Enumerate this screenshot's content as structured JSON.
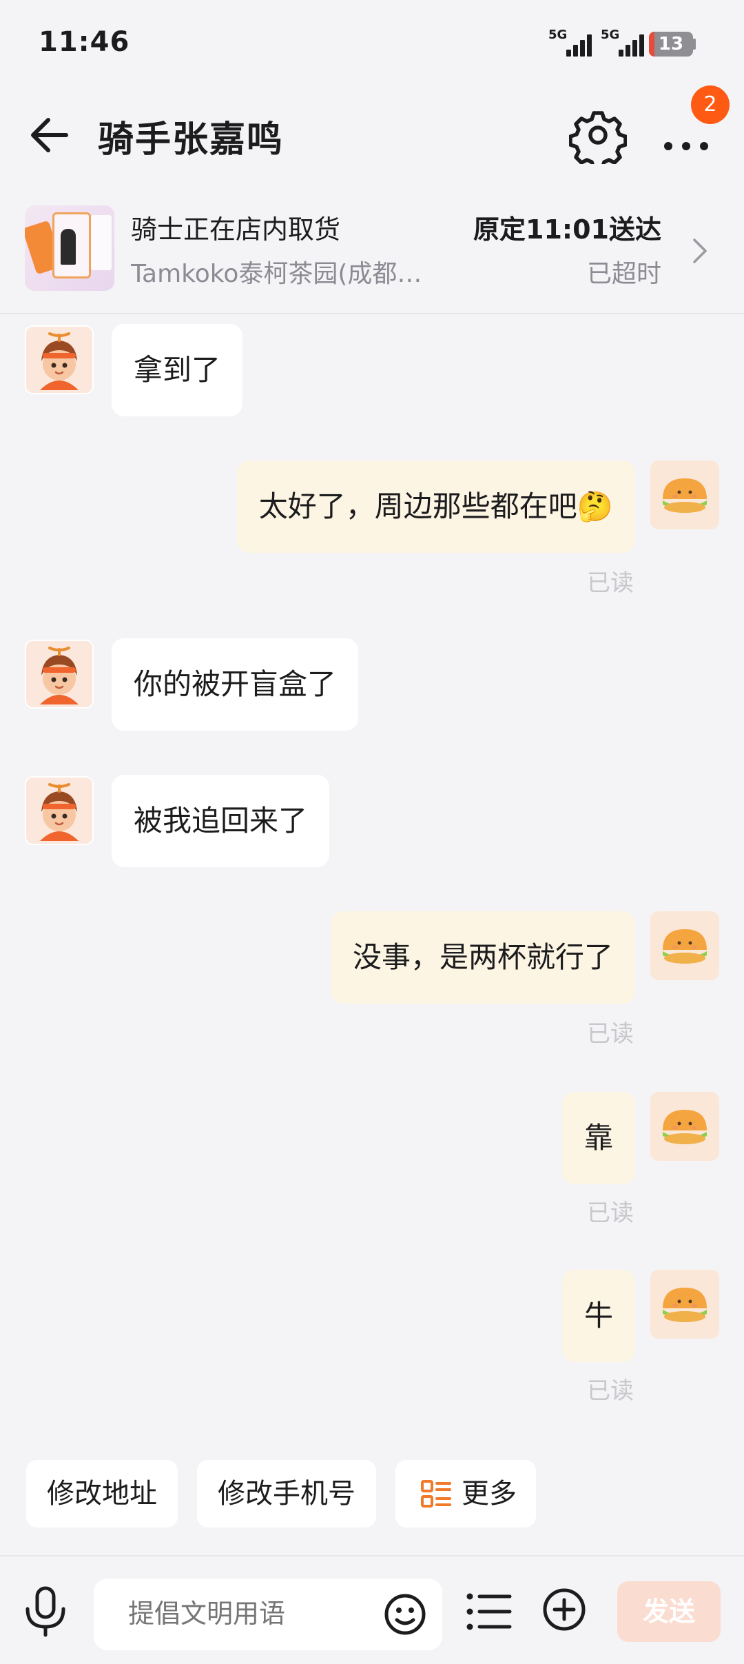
{
  "status_bar": {
    "time": "11:46",
    "network_1": "5G",
    "network_2": "5G",
    "battery_percent": 13,
    "battery_text": "13"
  },
  "header": {
    "title": "骑手张嘉鸣",
    "more_badge": "2",
    "icons": [
      "back-arrow-icon",
      "gear-icon",
      "more-dots-icon"
    ]
  },
  "order": {
    "status": "骑士正在店内取货",
    "shop": "Tamkoko泰柯茶园(成都双...",
    "eta": "原定11:01送达",
    "overdue": "已超时"
  },
  "messages": [
    {
      "from": "rider",
      "text": "拿到了"
    },
    {
      "from": "me",
      "text": "太好了，周边那些都在吧🤔",
      "status": "已读"
    },
    {
      "from": "rider",
      "text": "你的被开盲盒了"
    },
    {
      "from": "rider",
      "text": "被我追回来了"
    },
    {
      "from": "me",
      "text": "没事，是两杯就行了",
      "status": "已读"
    },
    {
      "from": "me",
      "text": "靠",
      "status": "已读"
    },
    {
      "from": "me",
      "text": "牛",
      "status": "已读"
    }
  ],
  "quick_actions": {
    "change_address": "修改地址",
    "change_phone": "修改手机号",
    "more": "更多"
  },
  "input_bar": {
    "placeholder": "提倡文明用语",
    "send_label": "发送"
  },
  "colors": {
    "accent_orange": "#ff5a14",
    "outgoing_bubble": "#fdf5e4",
    "incoming_bubble": "#ffffff",
    "send_button_disabled": "#fbdcd0",
    "background": "#f4f4f6"
  }
}
